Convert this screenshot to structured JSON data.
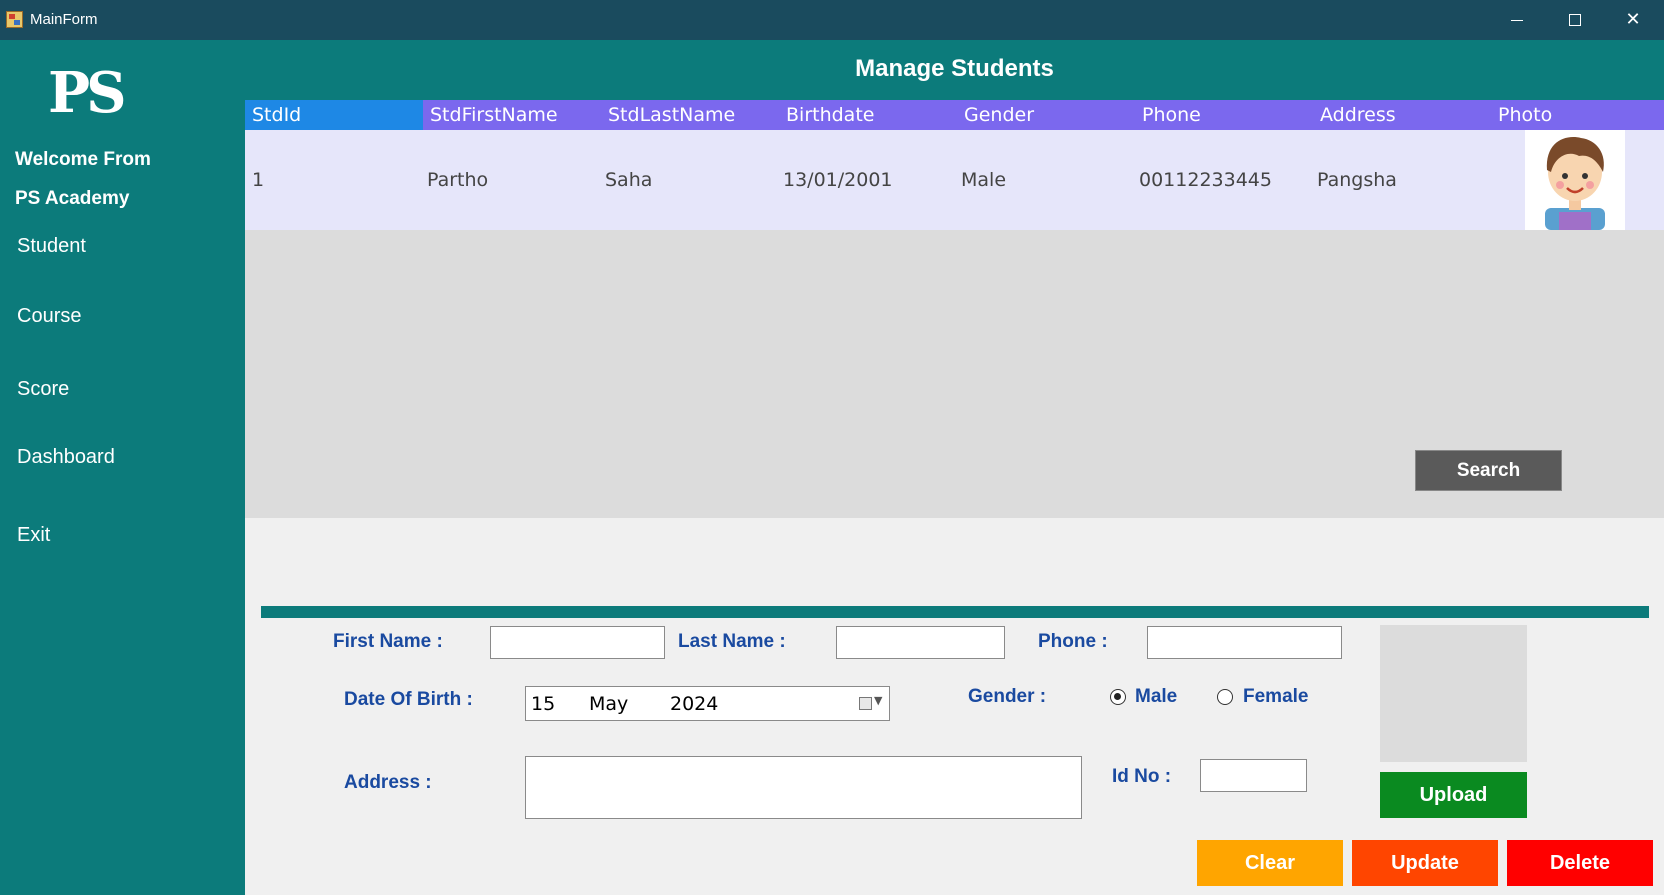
{
  "window": {
    "title": "MainForm"
  },
  "sidebar": {
    "logo": "PS",
    "welcome_line1": "Welcome From",
    "welcome_line2": "PS Academy",
    "items": [
      {
        "label": "Student"
      },
      {
        "label": "Course"
      },
      {
        "label": "Score"
      },
      {
        "label": "Dashboard"
      },
      {
        "label": "Exit"
      }
    ]
  },
  "header": {
    "title": "Manage Students"
  },
  "grid": {
    "columns": [
      "StdId",
      "StdFirstName",
      "StdLastName",
      "Birthdate",
      "Gender",
      "Phone",
      "Address",
      "Photo"
    ],
    "rows": [
      {
        "id": "1",
        "first": "Partho",
        "last": "Saha",
        "birthdate": "13/01/2001",
        "gender": "Male",
        "phone": "00112233445",
        "address": "Pangsha",
        "photo": "avatar-boy"
      }
    ]
  },
  "search": {
    "label": "Search"
  },
  "form": {
    "first_name_label": "First Name :",
    "last_name_label": "Last Name :",
    "phone_label": "Phone :",
    "dob_label": "Date Of Birth :",
    "dob": {
      "day": "15",
      "month": "May",
      "year": "2024"
    },
    "gender_label": "Gender :",
    "gender_options": [
      {
        "label": "Male",
        "checked": true
      },
      {
        "label": "Female",
        "checked": false
      }
    ],
    "address_label": "Address :",
    "id_label": "Id No :"
  },
  "buttons": {
    "upload": "Upload",
    "clear": "Clear",
    "update": "Update",
    "delete": "Delete"
  },
  "colors": {
    "teal": "#0c7b7b",
    "title_bar": "#1a4b5e",
    "grid_header": "#7b68ee",
    "grid_header_selected": "#1e88e5",
    "row": "#e6e6fa",
    "upload": "#0a8a20",
    "clear": "#ffa500",
    "update": "#ff4500",
    "delete": "#ff0000"
  }
}
